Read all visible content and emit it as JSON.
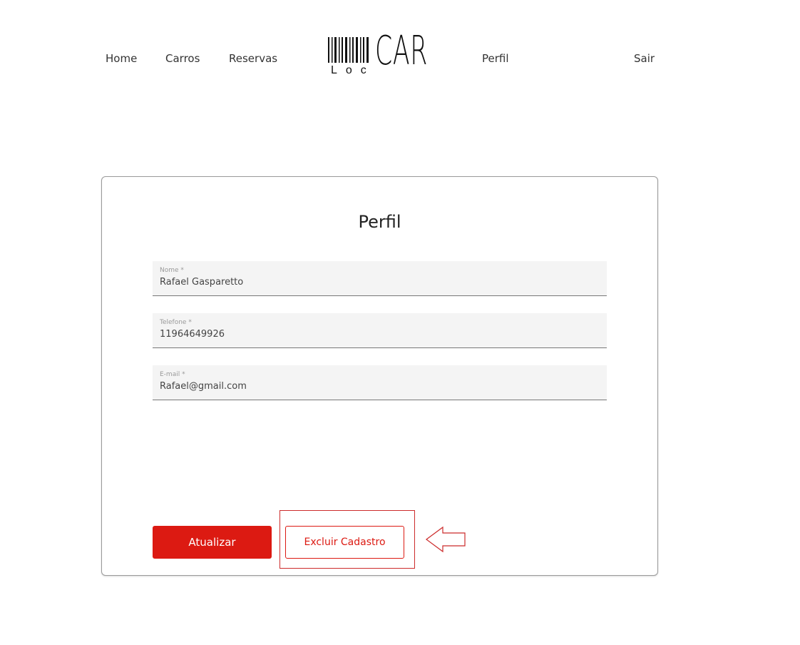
{
  "nav": {
    "home": "Home",
    "cars": "Carros",
    "reservas": "Reservas",
    "perfil": "Perfil",
    "sair": "Sair"
  },
  "logo": {
    "loc": "Loc",
    "car": "CAR"
  },
  "profile": {
    "title": "Perfil",
    "fields": {
      "nome": {
        "label": "Nome *",
        "value": "Rafael Gasparetto"
      },
      "telefone": {
        "label": "Telefone *",
        "value": "11964649926"
      },
      "email": {
        "label": "E-mail *",
        "value": "Rafael@gmail.com"
      }
    },
    "update_label": "Atualizar",
    "delete_label": "Excluir Cadastro"
  },
  "colors": {
    "accent": "#dc1a12",
    "annotation": "#cc2b2b"
  },
  "icons": {
    "logo_barcode": "barcode-icon",
    "annotation_arrow": "left-arrow-icon"
  }
}
